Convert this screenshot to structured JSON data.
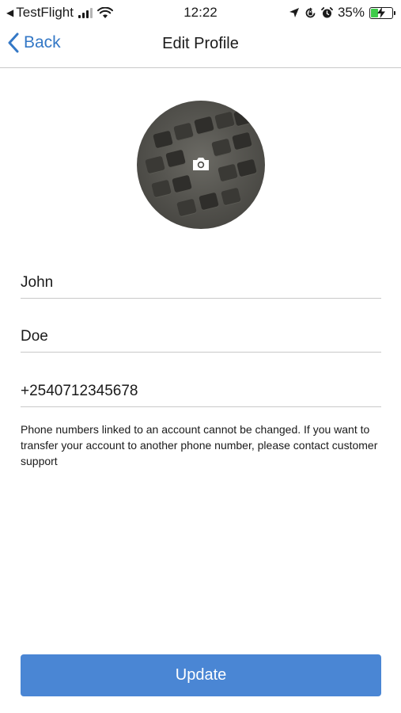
{
  "status_bar": {
    "back_app": "TestFlight",
    "time": "12:22",
    "battery": "35%",
    "battery_level": 0.35,
    "icons": [
      "signal-icon",
      "wifi-icon",
      "location-icon",
      "lock-rotation-icon",
      "alarm-icon",
      "battery-icon"
    ]
  },
  "nav": {
    "back_label": "Back",
    "title": "Edit Profile"
  },
  "avatar": {
    "icon": "camera-icon"
  },
  "form": {
    "first_name": "John",
    "last_name": "Doe",
    "phone": "+2540712345678",
    "help_text": "Phone numbers linked to an account cannot be changed. If you want to transfer your account to another phone number, please contact customer support"
  },
  "actions": {
    "update_label": "Update"
  },
  "colors": {
    "accent": "#3478c6",
    "button": "#4a86d4",
    "battery": "#3ecb4a"
  }
}
